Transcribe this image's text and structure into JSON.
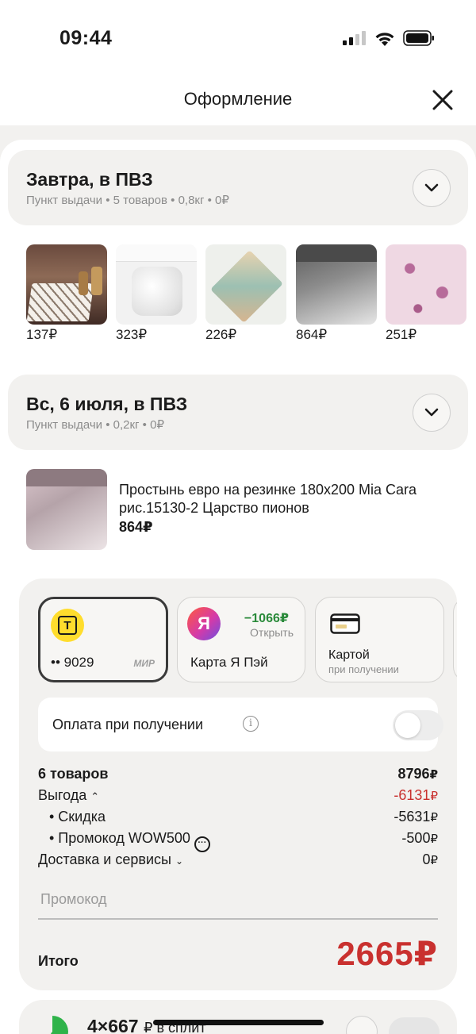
{
  "status_bar": {
    "time": "09:44"
  },
  "header": {
    "title": "Оформление"
  },
  "groups": [
    {
      "title": "Завтра, в ПВЗ",
      "subtitle": "Пункт выдачи • 5 товаров • 0,8кг • 0₽"
    },
    {
      "title": "Вс, 6 июля, в ПВЗ",
      "subtitle": "Пункт выдачи • 0,2кг • 0₽"
    }
  ],
  "products": [
    {
      "price": "137₽",
      "image_label": "Коврик для сушки посуды"
    },
    {
      "price": "323₽",
      "image_label": "Комплект наволочек"
    },
    {
      "price": "226₽",
      "image_label": "Салфетки"
    },
    {
      "price": "864₽",
      "image_label": "Простыня на резинке"
    },
    {
      "price": "251₽",
      "image_label": "Ткань с цветами"
    }
  ],
  "single_product": {
    "name": "Простынь евро на резинке 180х200 Mia Cara рис.15130-2 Царство пионов",
    "price": "864₽"
  },
  "payment": {
    "cards": [
      {
        "number": "•• 9029",
        "system": "МИР",
        "icon": "tbank-icon",
        "selected": true
      },
      {
        "title": "Карта Я Пэй",
        "bonus": "−1066₽",
        "action": "Открыть",
        "icon": "yandex-pay-icon"
      },
      {
        "title": "Картой",
        "subtitle": "при получении",
        "icon": "card-icon"
      }
    ],
    "cod_label": "Оплата при получении",
    "cod_enabled": false
  },
  "summary": {
    "items_label": "6 товаров",
    "items_value": "8796",
    "benefit_label": "Выгода",
    "benefit_value": "-6131",
    "discount_label": "• Скидка",
    "discount_value": "-5631",
    "promo_label": "• Промокод WOW500",
    "promo_value": "-500",
    "delivery_label": "Доставка и сервисы",
    "delivery_value": "0",
    "currency": "₽"
  },
  "promo_placeholder": "Промокод",
  "total": {
    "label": "Итого",
    "value": "2665₽"
  },
  "split": {
    "count": "4×667",
    "suffix": "₽ в сплит"
  }
}
